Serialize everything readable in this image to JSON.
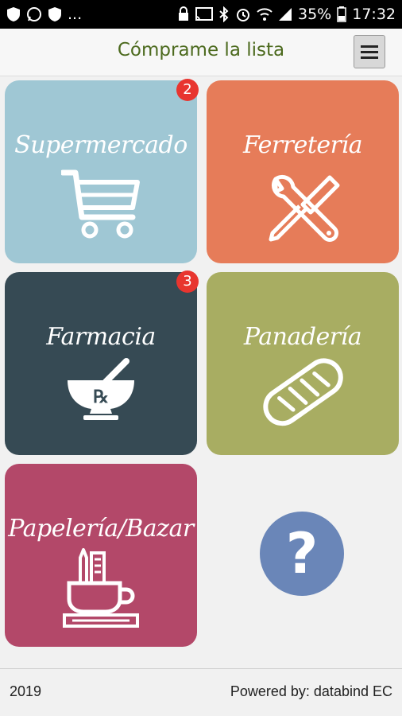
{
  "status_bar": {
    "battery": "35%",
    "time": "17:32",
    "ellipsis": "..."
  },
  "header": {
    "title": "Cómprame la lista"
  },
  "tiles": [
    {
      "label": "Supermercado",
      "icon": "shopping-cart-icon",
      "color": "#9fc7d4",
      "badge": "2"
    },
    {
      "label": "Ferretería",
      "icon": "wrench-screwdriver-icon",
      "color": "#e67c59",
      "badge": ""
    },
    {
      "label": "Farmacia",
      "icon": "mortar-pestle-rx-icon",
      "color": "#364a54",
      "badge": "3"
    },
    {
      "label": "Panadería",
      "icon": "bread-icon",
      "color": "#a8ad62",
      "badge": ""
    },
    {
      "label": "Papelería/Bazar",
      "icon": "stationery-mug-icon",
      "color": "#b34869",
      "badge": ""
    }
  ],
  "help": {
    "symbol": "?",
    "color": "#6a86b8"
  },
  "footer": {
    "year": "2019",
    "powered_by": "Powered by: databind EC"
  }
}
